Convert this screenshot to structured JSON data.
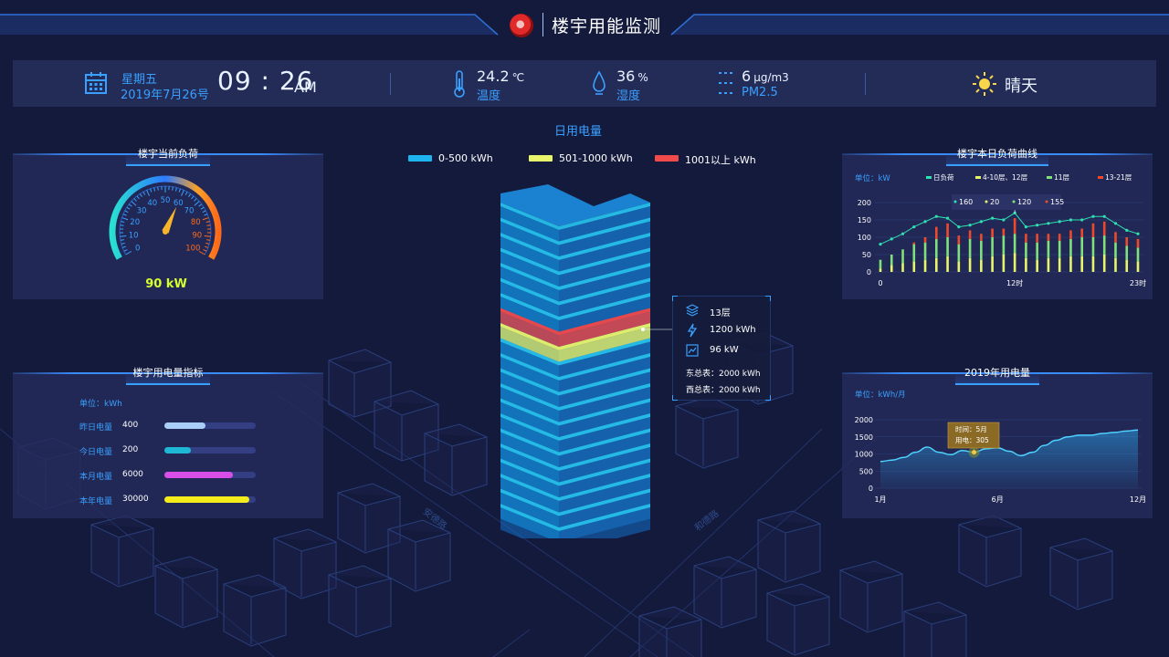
{
  "header": {
    "title": "楼宇用能监测",
    "logo": "brand-logo-icon"
  },
  "info": {
    "weekday": "星期五",
    "date": "2019年7月26号",
    "time": "09 : 26",
    "ampm": "AM",
    "temperature": {
      "value": "24.2",
      "unit": "℃",
      "label": "温度",
      "icon": "thermometer-icon"
    },
    "humidity": {
      "value": "36",
      "unit": "%",
      "label": "湿度",
      "icon": "water-drop-icon"
    },
    "pm25": {
      "value": "6",
      "unit": "μg/m3",
      "label": "PM2.5",
      "icon": "pm25-icon"
    },
    "weather": {
      "label": "晴天",
      "icon": "sun-icon"
    }
  },
  "current_load": {
    "title": "楼宇当前负荷",
    "gauge_ticks": [
      "0",
      "10",
      "20",
      "30",
      "40",
      "50",
      "60",
      "70",
      "80",
      "90",
      "100"
    ],
    "gauge_value": 60,
    "value_text": "90 kW"
  },
  "indicators": {
    "title": "楼宇用电量指标",
    "unit": "单位：kWh",
    "rows": [
      {
        "label": "昨日电量",
        "value": "400",
        "fill": 0.45,
        "color": "#a9cff8"
      },
      {
        "label": "今日电量",
        "value": "200",
        "fill": 0.29,
        "color": "#1fb7d6"
      },
      {
        "label": "本月电量",
        "value": "6000",
        "fill": 0.75,
        "color": "#d84ee6"
      },
      {
        "label": "本年电量",
        "value": "30000",
        "fill": 0.93,
        "color": "#f5ec1b"
      }
    ]
  },
  "center": {
    "title": "日用电量",
    "legend": [
      {
        "label": "0-500 kWh",
        "color": "#1db4ef"
      },
      {
        "label": "501-1000 kWh",
        "color": "#e8f56a"
      },
      {
        "label": "1001以上 kWh",
        "color": "#f04a4a"
      }
    ],
    "tooltip": {
      "floor": "13层",
      "power": "1200 kWh",
      "load": "96 kW",
      "east": "东总表：2000 kWh",
      "west": "西总表：2000 kWh"
    },
    "roads": [
      "安德路",
      "和德路"
    ]
  },
  "daily_curve": {
    "title": "楼宇本日负荷曲线",
    "unit": "单位：kW",
    "legend": [
      "日负荷",
      "4-10层、12层",
      "11层",
      "13-21层"
    ],
    "tooltip": [
      "160",
      "20",
      "120",
      "155"
    ],
    "y_ticks": [
      "0",
      "50",
      "100",
      "150",
      "200"
    ],
    "x_ticks": [
      "0",
      "12时",
      "23时"
    ],
    "chart_data": {
      "type": "bar",
      "x": [
        0,
        1,
        2,
        3,
        4,
        5,
        6,
        7,
        8,
        9,
        10,
        11,
        12,
        13,
        14,
        15,
        16,
        17,
        18,
        19,
        20,
        21,
        22,
        23
      ],
      "ylim": [
        0,
        200
      ],
      "series": [
        {
          "name": "4-10层、12层",
          "values": [
            10,
            20,
            25,
            30,
            35,
            40,
            45,
            30,
            40,
            35,
            45,
            50,
            55,
            40,
            35,
            40,
            40,
            45,
            45,
            45,
            50,
            40,
            35,
            30
          ],
          "color": "#e8f56a"
        },
        {
          "name": "11层",
          "values": [
            25,
            30,
            40,
            50,
            50,
            55,
            55,
            50,
            55,
            55,
            55,
            55,
            55,
            45,
            50,
            50,
            50,
            50,
            55,
            55,
            55,
            45,
            40,
            40
          ],
          "color": "#80e07a"
        },
        {
          "name": "13-21层",
          "values": [
            0,
            0,
            0,
            5,
            15,
            35,
            40,
            25,
            25,
            20,
            25,
            20,
            45,
            25,
            25,
            20,
            20,
            25,
            25,
            40,
            40,
            30,
            25,
            25
          ],
          "color": "#ee4a2a"
        },
        {
          "name": "日负荷",
          "values": [
            80,
            95,
            110,
            130,
            145,
            160,
            155,
            130,
            135,
            145,
            155,
            150,
            170,
            130,
            135,
            140,
            145,
            150,
            150,
            160,
            160,
            140,
            120,
            110
          ],
          "color": "#2fe0b0"
        }
      ]
    }
  },
  "annual": {
    "title": "2019年用电量",
    "unit": "单位：kWh/月",
    "y_ticks": [
      "0",
      "500",
      "1000",
      "1500",
      "2000"
    ],
    "x_ticks": [
      "1月",
      "6月",
      "12月"
    ],
    "tooltip": [
      "时间：5月",
      "用电：305"
    ],
    "chart_data": {
      "type": "area",
      "x": [
        1,
        1.5,
        2,
        2.5,
        3,
        3.5,
        4,
        4.5,
        5,
        5.5,
        6,
        6.5,
        7,
        7.5,
        8,
        8.5,
        9,
        9.5,
        10,
        10.5,
        11,
        11.5,
        12
      ],
      "values": [
        780,
        820,
        900,
        1050,
        1200,
        1050,
        980,
        1100,
        1050,
        1150,
        1180,
        1080,
        950,
        1050,
        1250,
        1400,
        1500,
        1550,
        1550,
        1600,
        1630,
        1670,
        1700
      ],
      "ylim": [
        0,
        2000
      ]
    }
  }
}
